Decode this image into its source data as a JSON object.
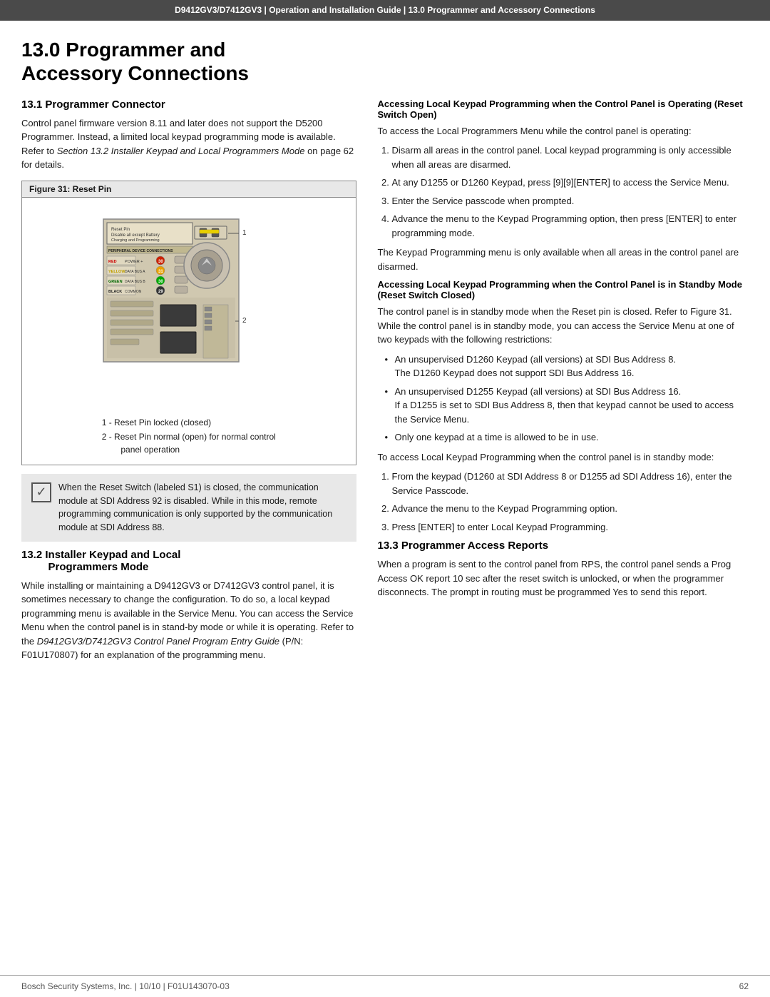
{
  "header": {
    "model": "D9412GV3/D7412GV3",
    "guide": "Operation and Installation Guide",
    "section": "13.0 Programmer and Accessory Connections"
  },
  "chapter": {
    "number": "13.0",
    "title": "Programmer and\nAccessory Connections"
  },
  "section_13_1": {
    "heading": "13.1   Programmer Connector",
    "body1": "Control panel firmware version 8.11 and later does not support the D5200 Programmer. Instead, a limited local keypad programming mode is available. Refer to ",
    "body1_italic": "Section 13.2 Installer Keypad and Local Programmers Mode",
    "body1_end": " on page 62 for details.",
    "figure_title": "Figure 31:  Reset Pin",
    "figure_caption1": "1 -   Reset Pin locked (closed)",
    "figure_caption2": "2 -   Reset Pin normal (open) for normal control\n        panel operation",
    "note_text": "When the Reset Switch (labeled S1) is closed, the communication module at SDI Address 92 is disabled. While in this mode, remote programming communication is only supported by the communication module at SDI Address 88."
  },
  "section_13_2": {
    "heading": "13.2   Installer Keypad and Local\n            Programmers Mode",
    "body1": "While installing or maintaining a D9412GV3 or D7412GV3 control panel, it is sometimes necessary to change the configuration. To do so, a local keypad programming menu is available in the Service Menu. You can access the Service Menu when the control panel is in stand-by mode or while it is operating. Refer to the ",
    "body1_italic": "D9412GV3/D7412GV3 Control Panel Program Entry Guide",
    "body1_mid": " (P/N: F01U170807) for an explanation of the programming menu."
  },
  "right_col": {
    "heading_operating": "Accessing Local Keypad Programming when the Control Panel is Operating (Reset Switch Open)",
    "operating_intro": "To access the Local Programmers Menu while the control panel is operating:",
    "operating_steps": [
      "Disarm all areas in the control panel. Local keypad programming is only accessible when all areas are disarmed.",
      "At any D1255 or D1260 Keypad, press [9][9][ENTER] to access the Service Menu.",
      "Enter the Service passcode when prompted.",
      "Advance the menu to the Keypad Programming option, then press [ENTER] to enter programming mode."
    ],
    "operating_note": "The Keypad Programming menu is only available when all areas in the control panel are disarmed.",
    "heading_standby": "Accessing Local Keypad Programming when the Control Panel is in Standby Mode (Reset Switch Closed)",
    "standby_intro": "The control panel is in standby mode when the Reset pin is closed. Refer to Figure 31. While the control panel is in standby mode, you can access the Service Menu at one of two keypads with the following restrictions:",
    "standby_bullets": [
      "An unsupervised D1260 Keypad (all versions) at SDI Bus Address 8.\nThe D1260 Keypad does not support SDI Bus Address 16.",
      "An unsupervised D1255 Keypad (all versions) at SDI Bus Address 16.\nIf a D1255 is set to SDI Bus Address 8, then that keypad cannot be used to access the Service Menu.",
      "Only one keypad at a time is allowed to be in use."
    ],
    "standby_access_intro": "To access Local Keypad Programming when the control panel is in standby mode:",
    "standby_steps": [
      "From the keypad (D1260 at SDI Address 8 or D1255 ad SDI Address 16), enter the Service Passcode.",
      "Advance the menu to the Keypad Programming option.",
      "Press [ENTER] to enter Local Keypad Programming."
    ]
  },
  "section_13_3": {
    "heading": "13.3   Programmer Access Reports",
    "body": "When a program is sent to the control panel from RPS, the control panel sends a Prog Access OK report 10 sec after the reset switch is unlocked, or when the programmer disconnects. The prompt in routing must be programmed Yes to send this report."
  },
  "footer": {
    "company": "Bosch Security Systems, Inc.",
    "date": "10/10",
    "part_number": "F01U143070-03",
    "page": "62"
  }
}
